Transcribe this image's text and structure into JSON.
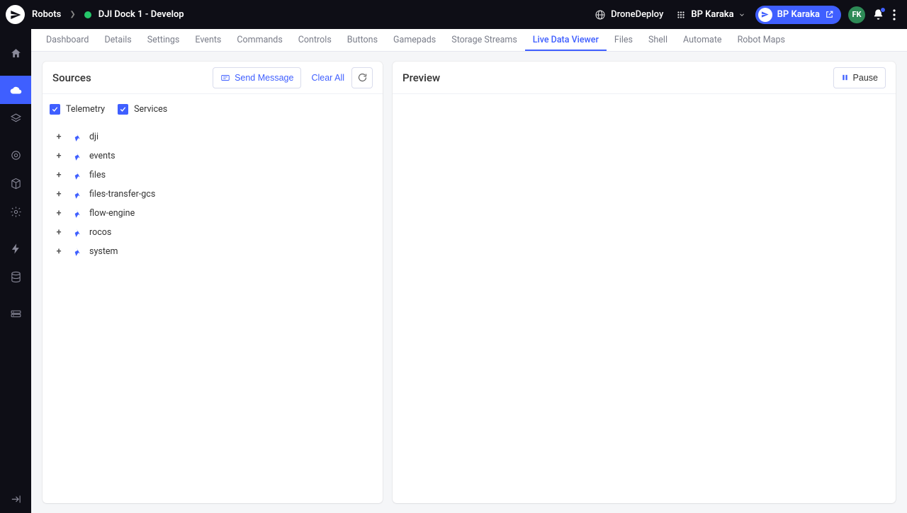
{
  "header": {
    "breadcrumb_root": "Robots",
    "robot_name": "DJI Dock 1 - Develop",
    "org_name": "DroneDeploy",
    "project_name": "BP Karaka",
    "pill_label": "BP Karaka",
    "avatar_initials": "FK"
  },
  "leftrail": {
    "items": [
      {
        "name": "home-icon"
      },
      {
        "name": "cloud-icon",
        "active": true
      },
      {
        "name": "layers-icon"
      },
      {
        "name": "target-icon"
      },
      {
        "name": "cube-icon"
      },
      {
        "name": "gear-icon"
      },
      {
        "name": "bolt-icon"
      },
      {
        "name": "database-icon"
      },
      {
        "name": "drive-icon"
      }
    ]
  },
  "tabs": [
    {
      "label": "Dashboard"
    },
    {
      "label": "Details"
    },
    {
      "label": "Settings"
    },
    {
      "label": "Events"
    },
    {
      "label": "Commands"
    },
    {
      "label": "Controls"
    },
    {
      "label": "Buttons"
    },
    {
      "label": "Gamepads"
    },
    {
      "label": "Storage Streams"
    },
    {
      "label": "Live Data Viewer",
      "active": true
    },
    {
      "label": "Files"
    },
    {
      "label": "Shell"
    },
    {
      "label": "Automate"
    },
    {
      "label": "Robot Maps"
    }
  ],
  "sources_panel": {
    "title": "Sources",
    "send_message_label": "Send Message",
    "clear_all_label": "Clear All",
    "filters": {
      "telemetry": {
        "label": "Telemetry",
        "checked": true
      },
      "services": {
        "label": "Services",
        "checked": true
      }
    },
    "tree": [
      {
        "label": "dji"
      },
      {
        "label": "events"
      },
      {
        "label": "files"
      },
      {
        "label": "files-transfer-gcs"
      },
      {
        "label": "flow-engine"
      },
      {
        "label": "rocos"
      },
      {
        "label": "system"
      }
    ]
  },
  "preview_panel": {
    "title": "Preview",
    "pause_label": "Pause"
  },
  "colors": {
    "accent": "#3f5fff",
    "topbar_bg": "#0e0e16",
    "status_online": "#25c76a"
  }
}
